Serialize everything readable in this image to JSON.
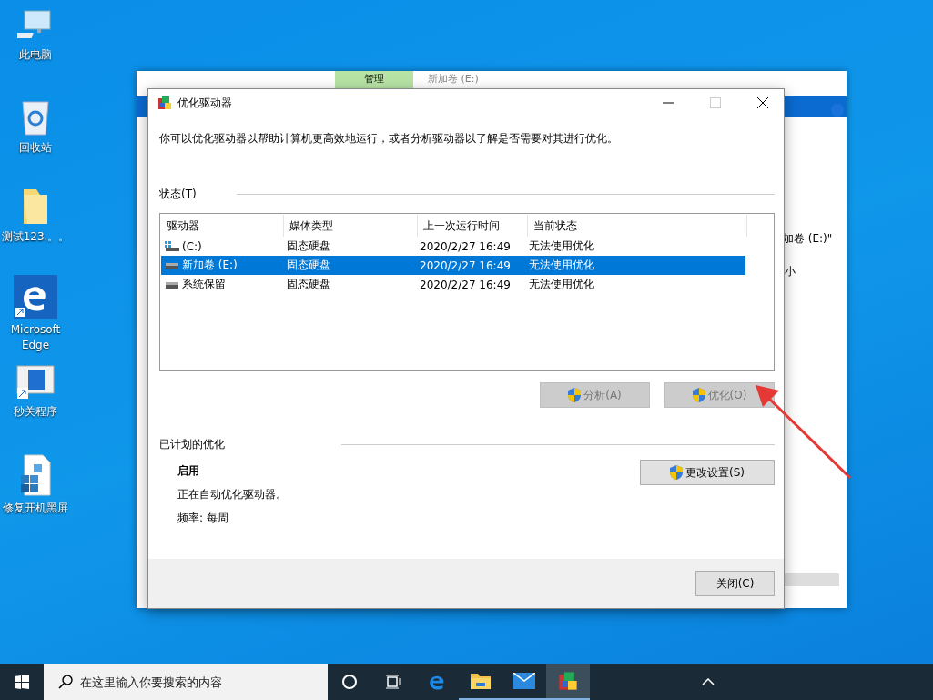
{
  "desktop_icons": [
    {
      "label": "此电脑",
      "kind": "computer"
    },
    {
      "label": "回收站",
      "kind": "recycle"
    },
    {
      "label": "测试123.。。",
      "kind": "folder"
    },
    {
      "label": "Microsoft Edge",
      "kind": "edge"
    },
    {
      "label": "秒关程序",
      "kind": "app"
    },
    {
      "label": "修复开机黑屏",
      "kind": "registry"
    }
  ],
  "explorer": {
    "ribbon_tab": "管理",
    "title": "新加卷 (E:)",
    "address_fragment": "加卷 (E:)\"",
    "column_fragment": "小"
  },
  "dialog": {
    "title": "优化驱动器",
    "description": "你可以优化驱动器以帮助计算机更高效地运行，或者分析驱动器以了解是否需要对其进行优化。",
    "status_label": "状态(T)",
    "columns": [
      "驱动器",
      "媒体类型",
      "上一次运行时间",
      "当前状态"
    ],
    "drives": [
      {
        "kind": "system",
        "name": "(C:)",
        "media": "固态硬盘",
        "last_run": "2020/2/27 16:49",
        "status": "无法使用优化",
        "selected": false
      },
      {
        "kind": "drive",
        "name": "新加卷 (E:)",
        "media": "固态硬盘",
        "last_run": "2020/2/27 16:49",
        "status": "无法使用优化",
        "selected": true
      },
      {
        "kind": "drive",
        "name": "系统保留",
        "media": "固态硬盘",
        "last_run": "2020/2/27 16:49",
        "status": "无法使用优化",
        "selected": false
      }
    ],
    "analyze_button": {
      "label": "分析(A)",
      "disabled": true
    },
    "optimize_button": {
      "label": "优化(O)",
      "disabled": true
    },
    "scheduled": {
      "label": "已计划的优化",
      "state": "启用",
      "description": "正在自动优化驱动器。",
      "frequency": "频率: 每周",
      "button": "更改设置(S)"
    },
    "close_button": "关闭(C)"
  },
  "taskbar": {
    "search_placeholder": "在这里输入你要搜索的内容",
    "apps": [
      {
        "kind": "cortana",
        "running": false,
        "selected": false
      },
      {
        "kind": "taskview",
        "running": false,
        "selected": false
      },
      {
        "kind": "edge",
        "running": false,
        "selected": false
      },
      {
        "kind": "explorer",
        "running": true,
        "selected": false
      },
      {
        "kind": "mail",
        "running": true,
        "selected": false
      },
      {
        "kind": "defrag",
        "running": true,
        "selected": true
      }
    ]
  }
}
